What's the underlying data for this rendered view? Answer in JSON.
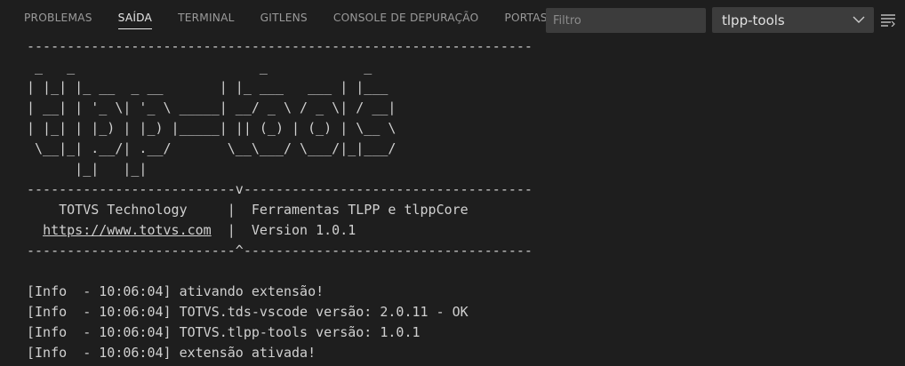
{
  "tabs": [
    {
      "label": "PROBLEMAS",
      "active": false
    },
    {
      "label": "SAÍDA",
      "active": true
    },
    {
      "label": "TERMINAL",
      "active": false
    },
    {
      "label": "GITLENS",
      "active": false
    },
    {
      "label": "CONSOLE DE DEPURAÇÃO",
      "active": false
    },
    {
      "label": "PORTAS",
      "active": false
    }
  ],
  "filter": {
    "placeholder": "Filtro",
    "value": ""
  },
  "channel_select": {
    "value": "tlpp-tools"
  },
  "icons": {
    "dropdown": "chevron-down-icon",
    "output_lines": "list-lines-icon"
  },
  "colors": {
    "background": "#1e1e1e",
    "input_background": "#3c3c3c",
    "text": "#cccccc",
    "active_tab": "#e7e7e7",
    "inactive_tab": "#9a9a9a"
  },
  "banner": {
    "rule_top": "---------------------------------------------------------------",
    "art": [
      " _   _                       _            _   ",
      "| |_| |_ __  _ __       | |_ ___   ___ | |___ ",
      "| __| | '_ \\| '_ \\ _____| __/ _ \\ / _ \\| / __|",
      "| |_| | |_) | |_) |_____| || (_) | (_) | \\__ \\",
      " \\__|_| .__/| .__/       \\__\\___/ \\___/|_|___/",
      "      |_|   |_|"
    ],
    "rule_mid": "--------------------------v------------------------------------",
    "info_line_1": {
      "prefix": "    TOTVS Technology     |  ",
      "suffix": "Ferramentas TLPP e tlppCore"
    },
    "info_line_2": {
      "prefix": "  ",
      "link": "https://www.totvs.com",
      "sep": "  |  ",
      "suffix": "Version 1.0.1"
    },
    "rule_bottom": "--------------------------^------------------------------------"
  },
  "log": [
    "[Info  - 10:06:04] ativando extensão!",
    "[Info  - 10:06:04] TOTVS.tds-vscode versão: 2.0.11 - OK",
    "[Info  - 10:06:04] TOTVS.tlpp-tools versão: 1.0.1",
    "[Info  - 10:06:04] extensão ativada!"
  ]
}
